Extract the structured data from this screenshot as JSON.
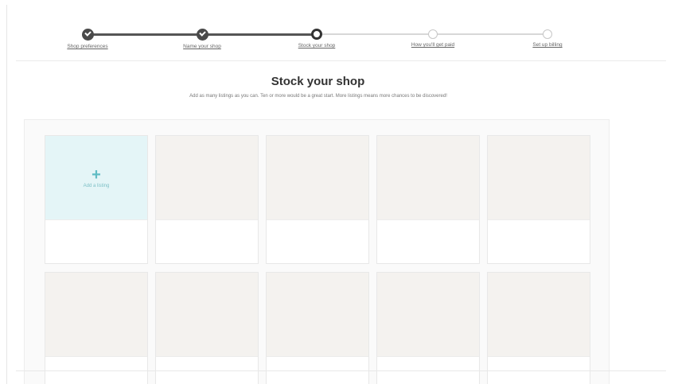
{
  "stepper": {
    "steps": [
      {
        "label": "Shop preferences",
        "state": "done"
      },
      {
        "label": "Name your shop",
        "state": "done"
      },
      {
        "label": "Stock your shop",
        "state": "current"
      },
      {
        "label": "How you'll get paid",
        "state": "todo"
      },
      {
        "label": "Set up billing",
        "state": "todo"
      }
    ]
  },
  "page": {
    "title": "Stock your shop",
    "subtitle": "Add as many listings as you can. Ten or more would be a great start. More listings means more chances to be discovered!"
  },
  "grid": {
    "add_listing_label": "Add a listing",
    "add_icon": "plus-icon",
    "accent_color": "#5fbcc4"
  }
}
